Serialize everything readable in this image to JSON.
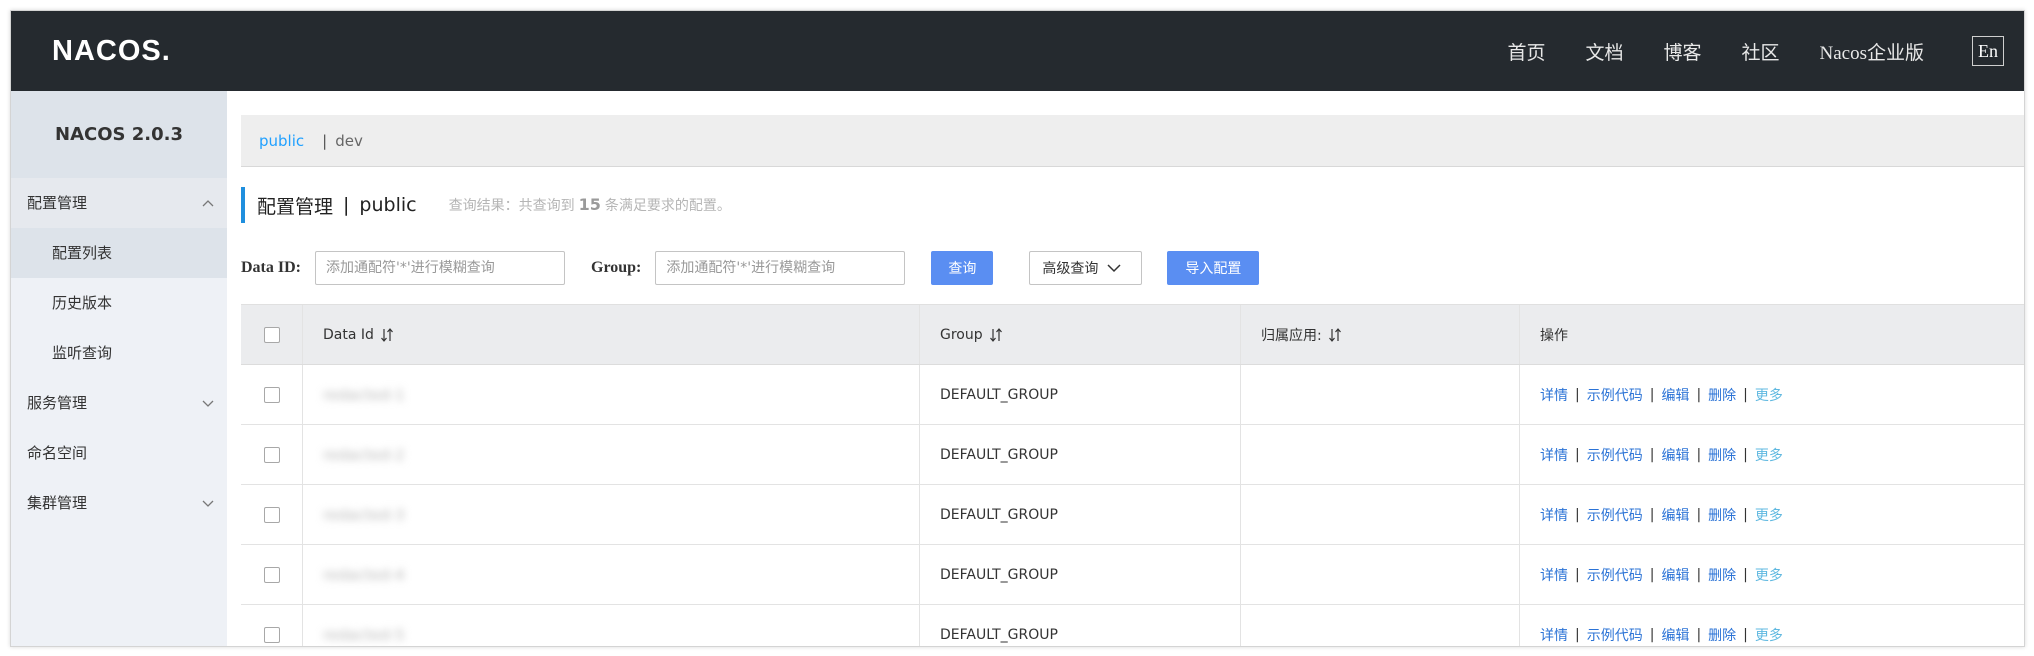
{
  "header": {
    "logo": "NACOS.",
    "nav": [
      "首页",
      "文档",
      "博客",
      "社区",
      "Nacos企业版"
    ],
    "lang": "En"
  },
  "sidebar": {
    "title": "NACOS 2.0.3",
    "groups": [
      {
        "label": "配置管理",
        "expanded": true,
        "items": [
          "配置列表",
          "历史版本",
          "监听查询"
        ]
      },
      {
        "label": "服务管理",
        "expanded": false
      },
      {
        "label": "命名空间"
      },
      {
        "label": "集群管理",
        "expanded": false
      }
    ]
  },
  "namespaces": {
    "active": "public",
    "separator": "|",
    "other": "dev"
  },
  "page": {
    "title": "配置管理",
    "pipe": "|",
    "namespace": "public",
    "result_prefix": "查询结果：共查询到",
    "result_count": "15",
    "result_suffix": "条满足要求的配置。"
  },
  "search": {
    "dataid_label": "Data ID:",
    "dataid_placeholder": "添加通配符'*'进行模糊查询",
    "group_label": "Group:",
    "group_placeholder": "添加通配符'*'进行模糊查询",
    "query_btn": "查询",
    "advanced_btn": "高级查询",
    "import_btn": "导入配置"
  },
  "table": {
    "columns": [
      "Data Id",
      "Group",
      "归属应用:",
      "操作"
    ],
    "rows": [
      {
        "data_id": "redacted-1",
        "group": "DEFAULT_GROUP",
        "app": ""
      },
      {
        "data_id": "redacted-2",
        "group": "DEFAULT_GROUP",
        "app": ""
      },
      {
        "data_id": "redacted-3",
        "group": "DEFAULT_GROUP",
        "app": ""
      },
      {
        "data_id": "redacted-4",
        "group": "DEFAULT_GROUP",
        "app": ""
      },
      {
        "data_id": "redacted-5",
        "group": "DEFAULT_GROUP",
        "app": ""
      }
    ],
    "actions": [
      "详情",
      "示例代码",
      "编辑",
      "删除",
      "更多"
    ]
  },
  "colors": {
    "header_bg": "#252a2f",
    "primary": "#5a8ef2",
    "link": "#2b73d6",
    "active_ns": "#20a0ff"
  }
}
